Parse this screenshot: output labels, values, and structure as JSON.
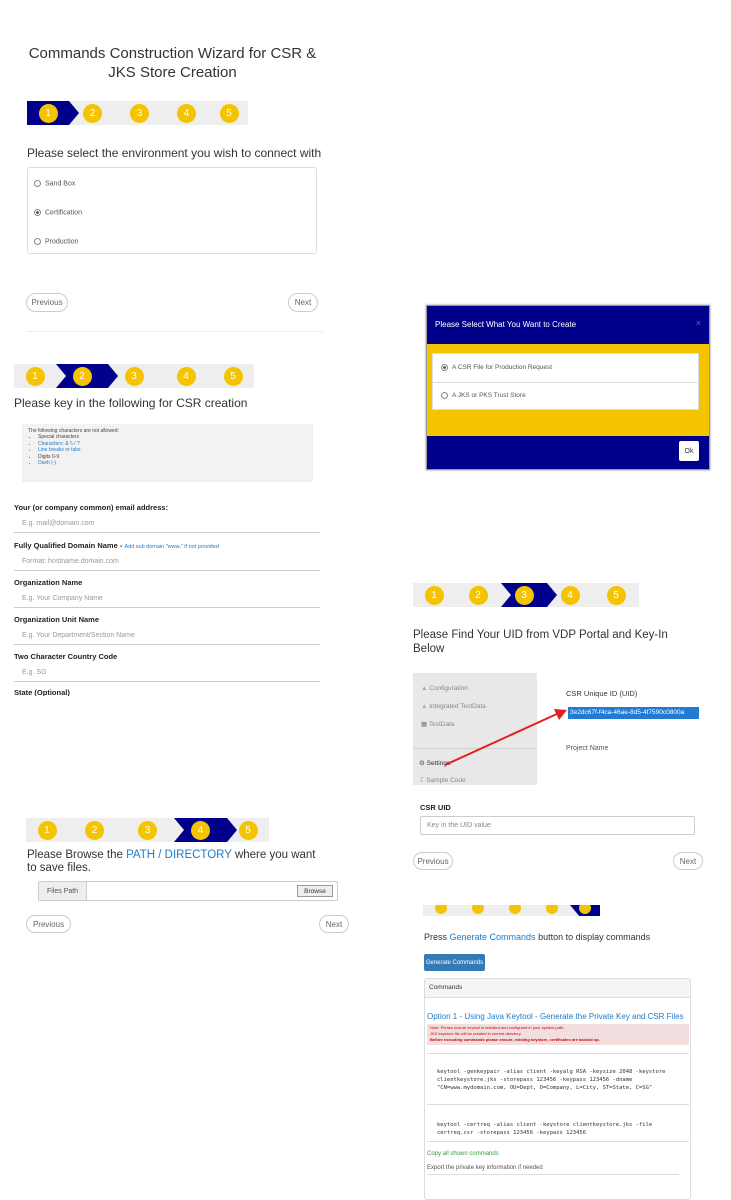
{
  "panel1": {
    "title_line1": "Commands Construction Wizard for CSR &",
    "title_line2": "JKS Store Creation",
    "steps": [
      "1",
      "2",
      "3",
      "4",
      "5"
    ],
    "prompt": "Please select the environment you wish to connect with",
    "options": [
      "Sand Box",
      "Certification",
      "Production"
    ],
    "selected_option": "Certification",
    "previous_label": "Previous",
    "next_label": "Next"
  },
  "modal": {
    "title": "Please Select What You Want to Create",
    "options": [
      "A CSR File for Production Request",
      "A JKS or PKS Trust Store"
    ],
    "ok_label": "Ok",
    "colors": {
      "header": "#00008b",
      "body": "#f5c400"
    }
  },
  "panel2": {
    "steps": [
      "1",
      "2",
      "3",
      "4",
      "5"
    ],
    "prompt": "Please key in the following for CSR creation",
    "note_title": "The following characters are not allowed:",
    "note_items": [
      "Special characters",
      "Characters: & \\\\ / ?",
      "Line breaks or tabs",
      "Digits 0-9",
      "Dash (-)"
    ],
    "fields": [
      {
        "label": "Your (or company common) email address:",
        "label_suffix": "",
        "placeholder": "E.g. mail@domain.com"
      },
      {
        "label": "Fully Qualified Domain Name -",
        "label_suffix": "Add sub domain \"www.\" if not provided",
        "placeholder": "Format: hostname.domain.com"
      },
      {
        "label": "Organization Name",
        "label_suffix": "",
        "placeholder": "E.g. Your Company Name"
      },
      {
        "label": "Organization Unit Name",
        "label_suffix": "",
        "placeholder": "E.g. Your Department/Section Name"
      },
      {
        "label": "Two Character Country Code",
        "label_suffix": "",
        "placeholder": "E.g. SG"
      }
    ],
    "state_label": "State (Optional)"
  },
  "panel3": {
    "steps": [
      "1",
      "2",
      "3",
      "4",
      "5"
    ],
    "prompt_line1": "Please Find Your UID from VDP Portal and Key-In",
    "prompt_line2": "Below",
    "portal_menu": [
      "Configuration",
      "Integrated TestData",
      "TestData",
      "Settings",
      "Sample Code"
    ],
    "csr_uid_header": "CSR Unique ID (UID)",
    "uid_value": "3e2dc67f-f4ca-46ae-8d5-4f7590c0800a",
    "project_name": "Project Name",
    "csr_uid_label": "CSR UID",
    "csr_uid_placeholder": "Key in the UID value",
    "previous_label": "Previous",
    "next_label": "Next"
  },
  "panel4": {
    "steps": [
      "1",
      "2",
      "3",
      "4",
      "5"
    ],
    "prompt_part1": "Please Browse the ",
    "prompt_highlight": "PATH / DIRECTORY",
    "prompt_part2": " where you want",
    "prompt_line2": "to save files.",
    "file_path_label": "Files Path",
    "browse_label": "Browse",
    "previous_label": "Previous",
    "next_label": "Next"
  },
  "panel5": {
    "prompt_part1": "Press ",
    "prompt_highlight": "Generate Commands",
    "prompt_part2": " button to display commands",
    "generate_label": "Generate Commands",
    "commands_header": "Commands",
    "option_title": "Option 1 - Using Java Keytool - Generate the Private Key and CSR Files",
    "warning_line1": "Note: Please ensure keytool is installed and configured in your system path.",
    "warning_line2": "JKS keystore file will be created in current directory.",
    "warning_line3": "Before executing commands please ensure, existing keystore, certificates are backed up.",
    "cmd1_line1": "keytool -genkeypair -alias client -keyalg RSA -keysize 2048 -keystore",
    "cmd1_line2": "clientkeystore.jks -storepass 123456 -keypass 123456 -dname",
    "cmd1_line3": "\"CN=www.mydomain.com, OU=Dept, O=Company, L=City, ST=State, C=SG\"",
    "cmd2_line1": "keytool -certreq -alias client -keystore clientkeystore.jks -file",
    "cmd2_line2": "certreq.csr -storepass 123456 -keypass 123456",
    "copy_label": "Copy all shown commands",
    "export_label": "Export the private key information if needed"
  },
  "colors": {
    "step_active": "#00008b",
    "step_circle": "#f5c400",
    "link_blue": "#1e7bc8",
    "primary_button": "#337ab7",
    "arrow_red": "#e02020"
  }
}
